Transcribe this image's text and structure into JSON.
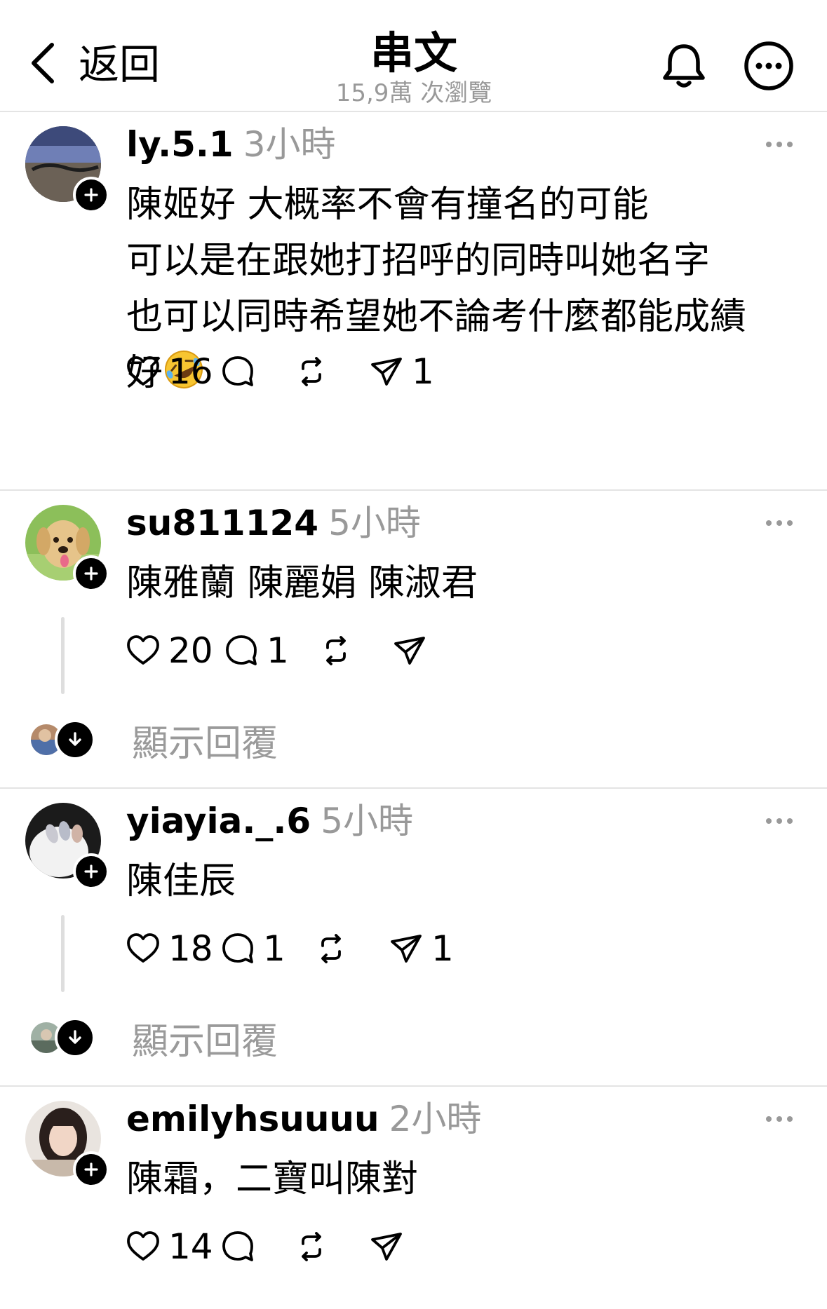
{
  "header": {
    "back_label": "返回",
    "title": "串文",
    "views": "15,9萬 次瀏覽",
    "bell_icon": "bell-icon",
    "more_icon": "more-circle-icon"
  },
  "comments": [
    {
      "username": "ly.5.1",
      "time": "3小時",
      "lines": [
        "陳姬好 大概率不會有撞名的可能",
        "可以是在跟她打招呼的同時叫她名字",
        "也可以同時希望她不論考什麼都能成績",
        "好"
      ],
      "emoji": "rolling-on-floor-laughing-emoji",
      "likes": "16",
      "replies": "",
      "reposts": "",
      "shares": "1",
      "show_replies": ""
    },
    {
      "username": "su811124",
      "time": "5小時",
      "lines": [
        "陳雅蘭 陳麗娟 陳淑君"
      ],
      "likes": "20",
      "replies": "1",
      "reposts": "",
      "shares": "",
      "show_replies": "顯示回覆"
    },
    {
      "username": "yiayia._.6",
      "time": "5小時",
      "lines": [
        "陳佳辰"
      ],
      "likes": "18",
      "replies": "1",
      "reposts": "",
      "shares": "1",
      "show_replies": "顯示回覆"
    },
    {
      "username": "emilyhsuuuu",
      "time": "2小時",
      "lines": [
        "陳霜，二寶叫陳對"
      ],
      "likes": "14",
      "replies": "",
      "reposts": "",
      "shares": "",
      "show_replies": ""
    }
  ],
  "colors": {
    "text": "#000000",
    "muted": "#999999",
    "divider": "#e4e4e4",
    "thread_line": "#dedede"
  }
}
